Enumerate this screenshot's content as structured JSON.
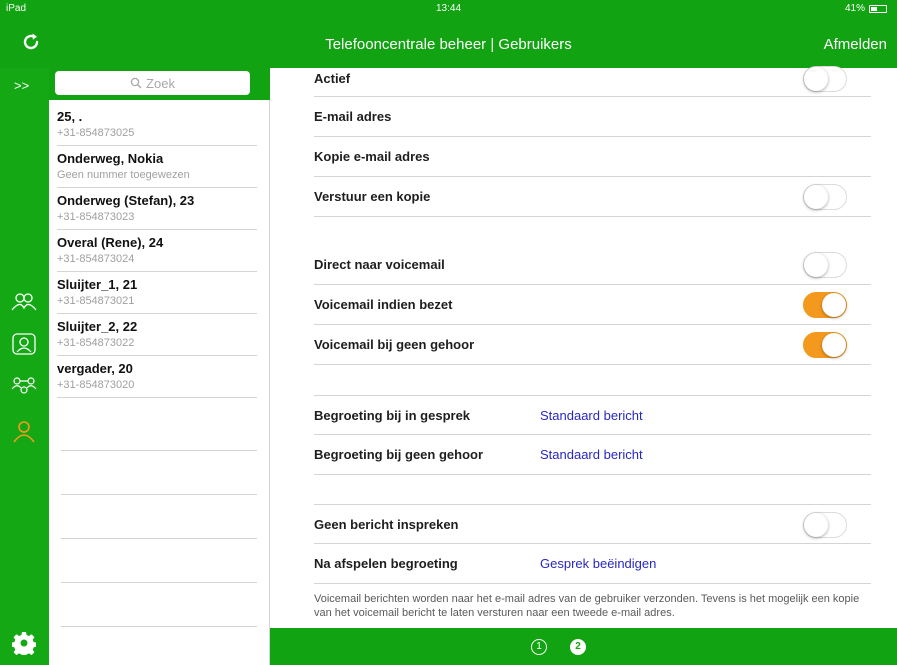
{
  "statusbar": {
    "device": "iPad",
    "time": "13:44",
    "battery": "41%"
  },
  "navbar": {
    "title": "Telefooncentrale beheer | Gebruikers",
    "logout": "Afmelden",
    "refresh_icon": "refresh-icon"
  },
  "sidebar": {
    "expand": ">>",
    "icons": [
      "users-group-icon",
      "user-card-icon",
      "user-network-icon",
      "user-icon"
    ],
    "settings_icon": "gear-icon"
  },
  "search": {
    "placeholder": "Zoek"
  },
  "users": [
    {
      "name": "25, .",
      "number": "+31-854873025"
    },
    {
      "name": "Onderweg, Nokia",
      "number": "Geen nummer toegewezen"
    },
    {
      "name": "Onderweg (Stefan), 23",
      "number": "+31-854873023"
    },
    {
      "name": "Overal (Rene), 24",
      "number": "+31-854873024"
    },
    {
      "name": "Sluijter_1, 21",
      "number": "+31-854873021"
    },
    {
      "name": "Sluijter_2, 22",
      "number": "+31-854873022"
    },
    {
      "name": "vergader, 20",
      "number": "+31-854873020"
    }
  ],
  "settings": {
    "actief": {
      "label": "Actief",
      "on": false
    },
    "email": {
      "label": "E-mail adres"
    },
    "kopie_email": {
      "label": "Kopie e-mail adres"
    },
    "verstuur_kopie": {
      "label": "Verstuur een kopie",
      "on": false
    },
    "direct_voicemail": {
      "label": "Direct naar voicemail",
      "on": false
    },
    "voicemail_bezet": {
      "label": "Voicemail indien bezet",
      "on": true
    },
    "voicemail_geen_gehoor": {
      "label": "Voicemail bij geen gehoor",
      "on": true
    },
    "begroeting_gesprek": {
      "label": "Begroeting bij in gesprek",
      "value": "Standaard bericht"
    },
    "begroeting_geen_gehoor": {
      "label": "Begroeting bij geen gehoor",
      "value": "Standaard bericht"
    },
    "geen_bericht": {
      "label": "Geen bericht inspreken",
      "on": false
    },
    "na_afspelen": {
      "label": "Na afspelen begroeting",
      "value": "Gesprek beëindigen"
    }
  },
  "note": "Voicemail berichten worden naar het e-mail adres van de gebruiker verzonden. Tevens is het mogelijk een kopie van het voicemail bericht te laten versturen naar een tweede e-mail adres.",
  "pagination": {
    "pages": [
      "1",
      "2"
    ],
    "current": "2"
  },
  "colors": {
    "brand_green": "#12a312",
    "toggle_on": "#f39a1e",
    "link_blue": "#2828c0"
  }
}
